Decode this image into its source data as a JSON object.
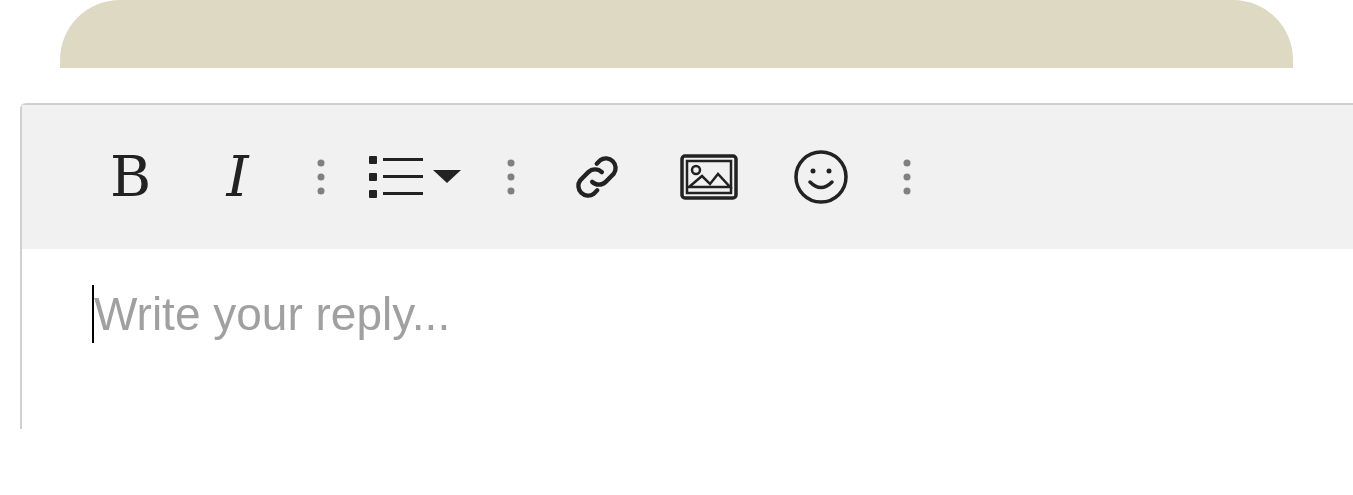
{
  "toolbar": [
    {
      "kind": "bold",
      "label": "B"
    },
    {
      "kind": "italic",
      "label": "I"
    },
    {
      "kind": "more"
    },
    {
      "kind": "list"
    },
    {
      "kind": "more"
    },
    {
      "kind": "link"
    },
    {
      "kind": "image"
    },
    {
      "kind": "emoji"
    },
    {
      "kind": "more"
    }
  ],
  "editor": {
    "placeholder": "Write your reply..."
  }
}
